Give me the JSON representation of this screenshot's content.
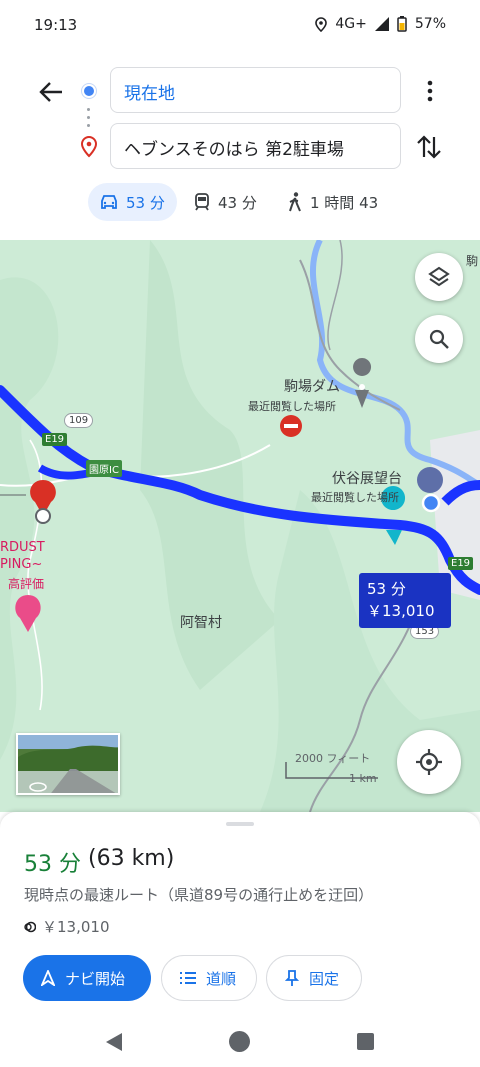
{
  "status_bar": {
    "time": "19:13",
    "network": "4G+",
    "battery": "57%"
  },
  "directions": {
    "origin": "現在地",
    "destination": "ヘブンスそのはら 第2駐車場"
  },
  "modes": [
    {
      "label": "53 分",
      "icon": "car-icon",
      "active": true
    },
    {
      "label": "43 分",
      "icon": "train-icon",
      "active": false
    },
    {
      "label": "1 時間 43",
      "icon": "walk-icon",
      "active": false
    }
  ],
  "map": {
    "labels": {
      "dam": "駒場ダム",
      "dam_sub": "最近閲覧した場所",
      "viewpoint": "伏谷展望台",
      "viewpoint_sub": "最近閲覧した場所",
      "village": "阿智村",
      "ic": "園原IC",
      "stardust1": "RDUST",
      "stardust2": "PING~",
      "stardust3": "高評価",
      "edge_top": "駒"
    },
    "road_badges": {
      "e19_left": "E19",
      "r109": "109",
      "e19_right": "E19",
      "r153": "153"
    },
    "route_box": {
      "time": "53 分",
      "toll": "￥13,010"
    },
    "scale": {
      "feet": "2000 フィート",
      "km": "1 km"
    }
  },
  "sheet": {
    "duration": "53 分",
    "distance": "(63 km)",
    "description": "現時点の最速ルート（県道89号の通行止めを迂回）",
    "toll": "￥13,010",
    "buttons": {
      "start": "ナビ開始",
      "steps": "道順",
      "pin": "固定"
    }
  },
  "colors": {
    "accent": "#1a73e8",
    "route": "#1a33ff",
    "duration_green": "#188038",
    "map_land": "#cdebd6",
    "water": "#8ab4f8"
  }
}
